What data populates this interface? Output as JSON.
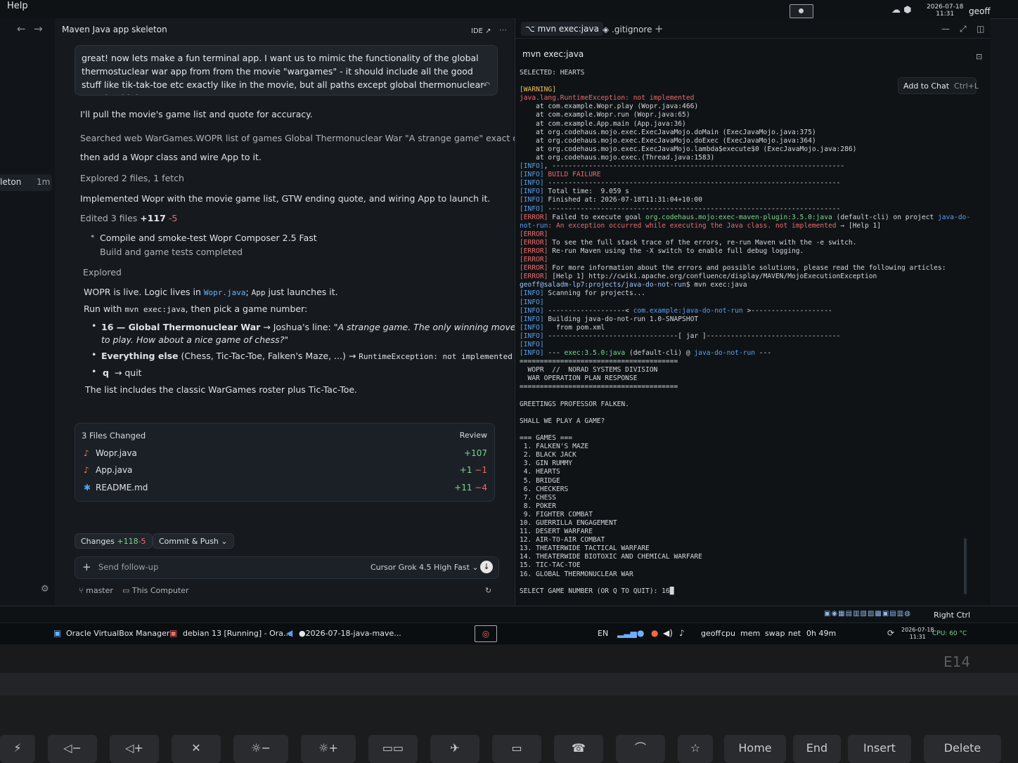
{
  "topbar": {
    "menu_help": "Help",
    "clock_date": "2026-07-18",
    "clock_time": "11:31",
    "user": "geoff"
  },
  "sidebar": {
    "history_item": "leton",
    "history_age": "1m"
  },
  "chat": {
    "title": "Maven Java app skeleton",
    "ide_label": "IDE ↗",
    "user_prompt": "great! now lets make a fun terminal app. I want us to mimic the functionality of the global thermostuclear war app from from the movie \"wargames\" - it should include all the good stuff like tik-tak-toe etc exactly like in the movie, but all paths except global thermonuclear war should throw",
    "msg1": "I'll pull the movie's game list and quote for accuracy.",
    "msg2": "Searched web WarGames.WOPR list of games Global Thermonuclear War \"A strange game\" exact quote",
    "msg3": "then add a Wopr class and wire App to it.",
    "msg4": "Explored 2 files, 1 fetch",
    "msg5": "Implemented Wopr with the movie game list, GTW ending quote, and wiring App to launch it.",
    "edited_label": "Edited 3 files",
    "edited_add": "+117",
    "edited_del": "-5",
    "task_title": "Compile and smoke-test Wopr Composer 2.5 Fast",
    "task_sub": "Build and game tests completed",
    "explored": "Explored",
    "wopr_live_a": "WOPR is live. Logic lives in ",
    "wopr_file": "Wopr.java",
    "wopr_live_b": "; ",
    "app_file": "App",
    "wopr_live_c": " just launches it.",
    "run_a": "Run with ",
    "run_cmd": "mvn exec:java",
    "run_b": ", then pick a game number:",
    "b1_bold": "16 — Global Thermonuclear War",
    "b1_rest": " → Joshua's line: ",
    "b1_quote1": "\"A strange game. The only winning move is not",
    "b1_quote2": "to play. How about a nice game of chess?\"",
    "b2_bold": "Everything else",
    "b2_rest": " (Chess, Tic-Tac-Toe, Falken's Maze, ...) → ",
    "b2_code": "RuntimeException: not implemented",
    "b3_bold": "q",
    "b3_rest": "→ quit",
    "closing": "The list includes the classic WarGames roster plus Tic-Tac-Toe.",
    "files_title": "3 Files Changed",
    "files_review": "Review",
    "files": [
      {
        "name": "Wopr.java",
        "add": "+107",
        "del": ""
      },
      {
        "name": "App.java",
        "add": "+1",
        "del": "−1"
      },
      {
        "name": "README.md",
        "add": "+11",
        "del": "−4"
      }
    ],
    "changes_label": "Changes",
    "changes_add": "+118",
    "changes_del": "-5",
    "commit_label": "Commit & Push ⌄",
    "followup_placeholder": "Send follow-up",
    "model": "Cursor Grok 4.5 High Fast ⌄",
    "branch": "master",
    "location": "This Computer"
  },
  "terminal": {
    "tab1": "mvn exec:java",
    "tab2": ".gitignore",
    "title": "mvn exec:java",
    "add_to_chat": "Add to Chat",
    "add_to_chat_key": "Ctrl+L",
    "lines": [
      [
        [
          "",
          "SELECTED: HEARTS"
        ]
      ],
      [
        [
          "",
          ""
        ]
      ],
      [
        [
          "w",
          "[WARNING]"
        ]
      ],
      [
        [
          "e",
          "java.lang.RuntimeException: not implemented"
        ]
      ],
      [
        [
          "",
          "    at com.example.Wopr.play (Wopr.java:466)"
        ]
      ],
      [
        [
          "",
          "    at com.example.Wopr.run (Wopr.java:65)"
        ]
      ],
      [
        [
          "",
          "    at com.example.App.main (App.java:36)"
        ]
      ],
      [
        [
          "",
          "    at org.codehaus.mojo.exec.ExecJavaMojo.doMain (ExecJavaMojo.java:375)"
        ]
      ],
      [
        [
          "",
          "    at org.codehaus.mojo.exec.ExecJavaMojo.doExec (ExecJavaMojo.java:364)"
        ]
      ],
      [
        [
          "",
          "    at org.codehaus.mojo.exec.ExecJavaMojo.lambda$execute$0 (ExecJavaMojo.java:286)"
        ]
      ],
      [
        [
          "",
          "    at org.codehaus.mojo.exec.(Thread.java:1583)"
        ]
      ],
      [
        [
          "i",
          "[INFO]"
        ],
        [
          "",
          ", ------------------------------------------------------------------------"
        ]
      ],
      [
        [
          "i",
          "[INFO]"
        ],
        [
          "e",
          " BUILD FAILURE"
        ]
      ],
      [
        [
          "i",
          "[INFO]"
        ],
        [
          "",
          " ------------------------------------------------------------------------"
        ]
      ],
      [
        [
          "i",
          "[INFO]"
        ],
        [
          "",
          " Total time:  9.059 s"
        ]
      ],
      [
        [
          "i",
          "[INFO]"
        ],
        [
          "",
          " Finished at: 2026-07-18T11:31:04+10:00"
        ]
      ],
      [
        [
          "i",
          "[INFO]"
        ],
        [
          "",
          " ------------------------------------------------------------------------"
        ]
      ],
      [
        [
          "e",
          "[ERROR]"
        ],
        [
          "",
          " Failed to execute goal "
        ],
        [
          "g",
          "org.codehaus.mojo:exec-maven-plugin:3.5.0:java"
        ],
        [
          "",
          " (default-cli) on project "
        ],
        [
          "c",
          "java-do-"
        ]
      ],
      [
        [
          "c",
          "not-run"
        ],
        [
          "e",
          ": An exception occurred while executing the Java class. not implemented"
        ],
        [
          "",
          " → [Help 1]"
        ]
      ],
      [
        [
          "e",
          "[ERROR]"
        ]
      ],
      [
        [
          "e",
          "[ERROR]"
        ],
        [
          "",
          " To see the full stack trace of the errors, re-run Maven with the -e switch."
        ]
      ],
      [
        [
          "e",
          "[ERROR]"
        ],
        [
          "",
          " Re-run Maven using the -X switch to enable full debug logging."
        ]
      ],
      [
        [
          "e",
          "[ERROR]"
        ]
      ],
      [
        [
          "e",
          "[ERROR]"
        ],
        [
          "",
          " For more information about the errors and possible solutions, please read the following articles:"
        ]
      ],
      [
        [
          "e",
          "[ERROR]"
        ],
        [
          "",
          " [Help 1] http://cwiki.apache.org/confluence/display/MAVEN/MojoExecutionException"
        ]
      ],
      [
        [
          "p",
          "geoff@saladm-lp7:projects/java-do-not-run"
        ],
        [
          "",
          "$ mvn exec:java"
        ]
      ],
      [
        [
          "i",
          "[INFO]"
        ],
        [
          "",
          " Scanning for projects..."
        ]
      ],
      [
        [
          "i",
          "[INFO]"
        ]
      ],
      [
        [
          "i",
          "[INFO]"
        ],
        [
          "",
          " -------------------< "
        ],
        [
          "c",
          "com.example:java-do-not-run"
        ],
        [
          "",
          " >--------------------"
        ]
      ],
      [
        [
          "i",
          "[INFO]"
        ],
        [
          "",
          " Building java-do-not-run 1.0-SNAPSHOT"
        ]
      ],
      [
        [
          "i",
          "[INFO]"
        ],
        [
          "",
          "   from pom.xml"
        ]
      ],
      [
        [
          "i",
          "[INFO]"
        ],
        [
          "",
          " --------------------------------[ jar ]---------------------------------"
        ]
      ],
      [
        [
          "i",
          "[INFO]"
        ]
      ],
      [
        [
          "i",
          "[INFO]"
        ],
        [
          "",
          " --- "
        ],
        [
          "g",
          "exec:3.5.0:java"
        ],
        [
          "",
          " (default-cli) @ "
        ],
        [
          "c",
          "java-do-not-run"
        ],
        [
          "",
          " ---"
        ]
      ],
      [
        [
          "",
          "======================================="
        ]
      ],
      [
        [
          "",
          "  WOPR  //  NORAD SYSTEMS DIVISION"
        ]
      ],
      [
        [
          "",
          "  WAR OPERATION PLAN RESPONSE"
        ]
      ],
      [
        [
          "",
          "======================================="
        ]
      ],
      [
        [
          "",
          ""
        ]
      ],
      [
        [
          "",
          "GREETINGS PROFESSOR FALKEN."
        ]
      ],
      [
        [
          "",
          ""
        ]
      ],
      [
        [
          "",
          "SHALL WE PLAY A GAME?"
        ]
      ],
      [
        [
          "",
          ""
        ]
      ],
      [
        [
          "",
          "=== GAMES ==="
        ]
      ],
      [
        [
          "",
          " 1. FALKEN'S MAZE"
        ]
      ],
      [
        [
          "",
          " 2. BLACK JACK"
        ]
      ],
      [
        [
          "",
          " 3. GIN RUMMY"
        ]
      ],
      [
        [
          "",
          " 4. HEARTS"
        ]
      ],
      [
        [
          "",
          " 5. BRIDGE"
        ]
      ],
      [
        [
          "",
          " 6. CHECKERS"
        ]
      ],
      [
        [
          "",
          " 7. CHESS"
        ]
      ],
      [
        [
          "",
          " 8. POKER"
        ]
      ],
      [
        [
          "",
          " 9. FIGHTER COMBAT"
        ]
      ],
      [
        [
          "",
          "10. GUERRILLA ENGAGEMENT"
        ]
      ],
      [
        [
          "",
          "11. DESERT WARFARE"
        ]
      ],
      [
        [
          "",
          "12. AIR-TO-AIR COMBAT"
        ]
      ],
      [
        [
          "",
          "13. THEATERWIDE TACTICAL WARFARE"
        ]
      ],
      [
        [
          "",
          "14. THEATERWIDE BIOTOXIC AND CHEMICAL WARFARE"
        ]
      ],
      [
        [
          "",
          "15. TIC-TAC-TOE"
        ]
      ],
      [
        [
          "",
          "16. GLOBAL THERMONUCLEAR WAR"
        ]
      ],
      [
        [
          "",
          ""
        ]
      ],
      [
        [
          "",
          "SELECT GAME NUMBER (OR Q TO QUIT): 16█"
        ]
      ]
    ]
  },
  "status": {
    "right_ctrl": "Right Ctrl"
  },
  "taskbar": {
    "items": [
      "Oracle VirtualBox Manager",
      "debian 13 [Running] - Ora...",
      "●2026-07-18-java-mave..."
    ],
    "lang": "EN",
    "monitors": [
      "geoff",
      "cpu",
      "mem",
      "swap",
      "net",
      "0h 49m"
    ],
    "clock_date": "2026-07-18",
    "clock_time": "11:31",
    "cpu_temp": "CPU: 60 °C"
  },
  "bezel": {
    "brand": "E14"
  },
  "keyboard": {
    "keys": [
      "Home",
      "End",
      "Insert",
      "Delete"
    ]
  }
}
